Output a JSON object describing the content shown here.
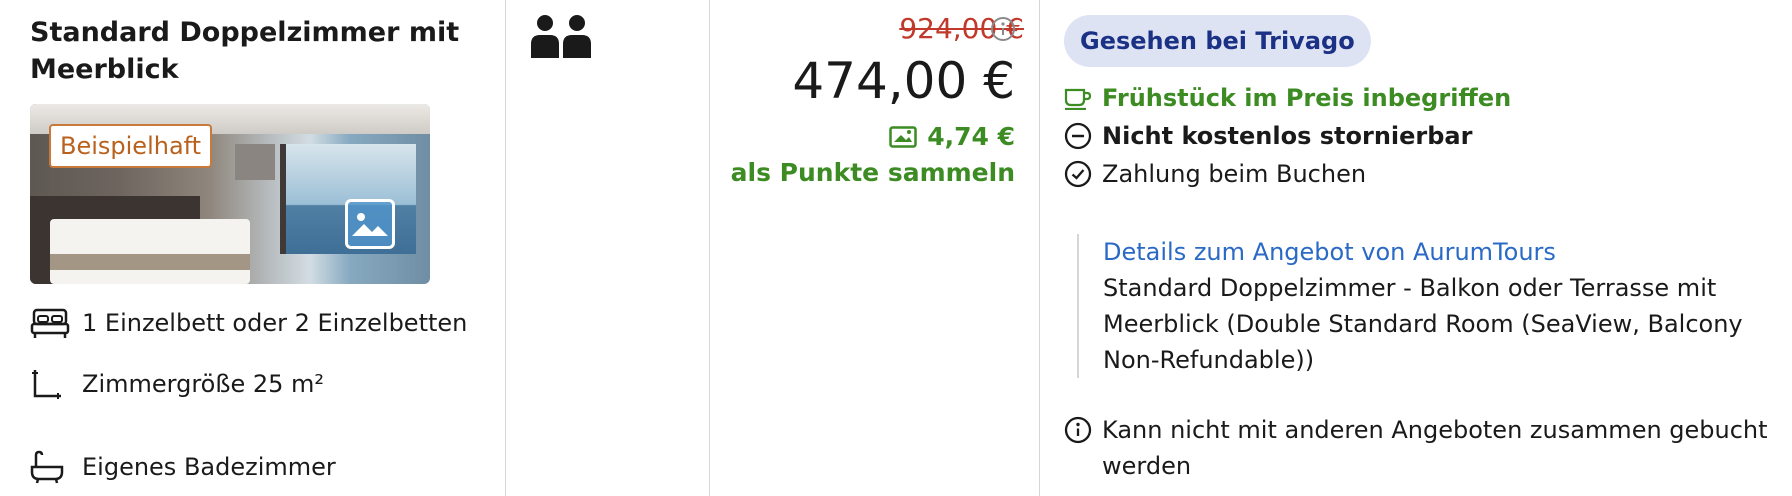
{
  "room": {
    "title": "Standard Doppelzimmer mit Meerblick",
    "photo_badge": "Beispielhaft",
    "features": [
      {
        "icon": "bed-icon",
        "label": "1 Einzelbett oder 2 Einzelbetten"
      },
      {
        "icon": "room-size-icon",
        "label": "Zimmergröße 25 m²"
      },
      {
        "icon": "bathtub-icon",
        "label": "Eigenes Badezimmer"
      }
    ]
  },
  "occupancy": {
    "icon": "two-persons-icon",
    "persons": 2
  },
  "pricing": {
    "old_price": "924,00 €",
    "price": "474,00 €",
    "points_value": "4,74 €",
    "points_text": "als Punkte sammeln"
  },
  "offer": {
    "source_badge": "Gesehen bei Trivago",
    "conditions": [
      {
        "icon": "coffee-cup-icon",
        "label": "Frühstück im Preis inbegriffen",
        "style": "green"
      },
      {
        "icon": "minus-circle-icon",
        "label": "Nicht kostenlos stornierbar",
        "style": "bold"
      },
      {
        "icon": "check-circle-icon",
        "label": "Zahlung beim Buchen",
        "style": "normal"
      }
    ],
    "details_link": "Details zum Angebot von AurumTours",
    "details_text": "Standard Doppelzimmer - Balkon oder Terrasse mit Meerblick (Double Standard Room (SeaView, Balcony Non-Refundable))",
    "note": "Kann nicht mit anderen Angeboten zusammen gebucht werden"
  },
  "colors": {
    "green": "#3c8c23",
    "strike_red": "#c0392b",
    "link_blue": "#2a69c6",
    "badge_bg": "#dde3f3",
    "badge_text": "#1b3185",
    "photo_badge": "#c9793a"
  }
}
